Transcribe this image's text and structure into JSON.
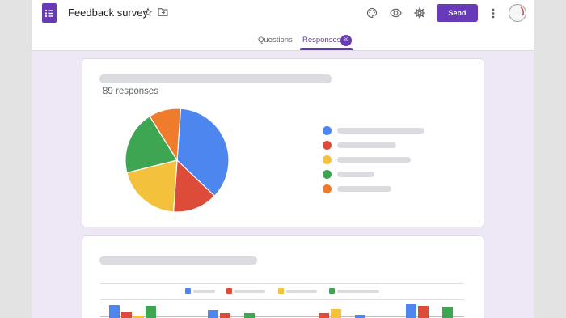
{
  "header": {
    "title": "Feedback survey",
    "send_label": "Send",
    "icons": [
      "forms-logo-icon",
      "star-icon",
      "move-to-folder-icon",
      "palette-icon",
      "preview-eye-icon",
      "settings-gear-icon",
      "more-vert-icon"
    ]
  },
  "tabs": {
    "questions_label": "Questions",
    "responses_label": "Responses",
    "responses_count": "89",
    "active": "Responses"
  },
  "summary_card": {
    "responses_text": "89 responses"
  },
  "colors": {
    "brand": "#673ab7",
    "blue": "#4285f4",
    "red": "#db4437",
    "yellow": "#f4b400",
    "green": "#0f9d58",
    "orange": "#ff6d00"
  },
  "chart_data": [
    {
      "type": "pie",
      "series": [
        {
          "color": "#4e86f0",
          "value": 36
        },
        {
          "color": "#dd4b39",
          "value": 14
        },
        {
          "color": "#f3c13c",
          "value": 20
        },
        {
          "color": "#3ea552",
          "value": 20
        },
        {
          "color": "#ef7b2d",
          "value": 10
        }
      ],
      "legend_colors": [
        "#4e86f0",
        "#dd4b39",
        "#f3c13c",
        "#3ea552",
        "#ef7b2d"
      ]
    },
    {
      "type": "bar",
      "series_colors": [
        "#4e86f0",
        "#dd4b39",
        "#f3c13c",
        "#3ea552"
      ],
      "groups": [
        [
          14,
          6,
          1,
          13
        ],
        [
          8,
          4,
          0,
          4
        ],
        [
          0,
          4,
          9,
          0,
          2
        ],
        [
          15,
          13,
          0,
          12
        ]
      ]
    }
  ]
}
